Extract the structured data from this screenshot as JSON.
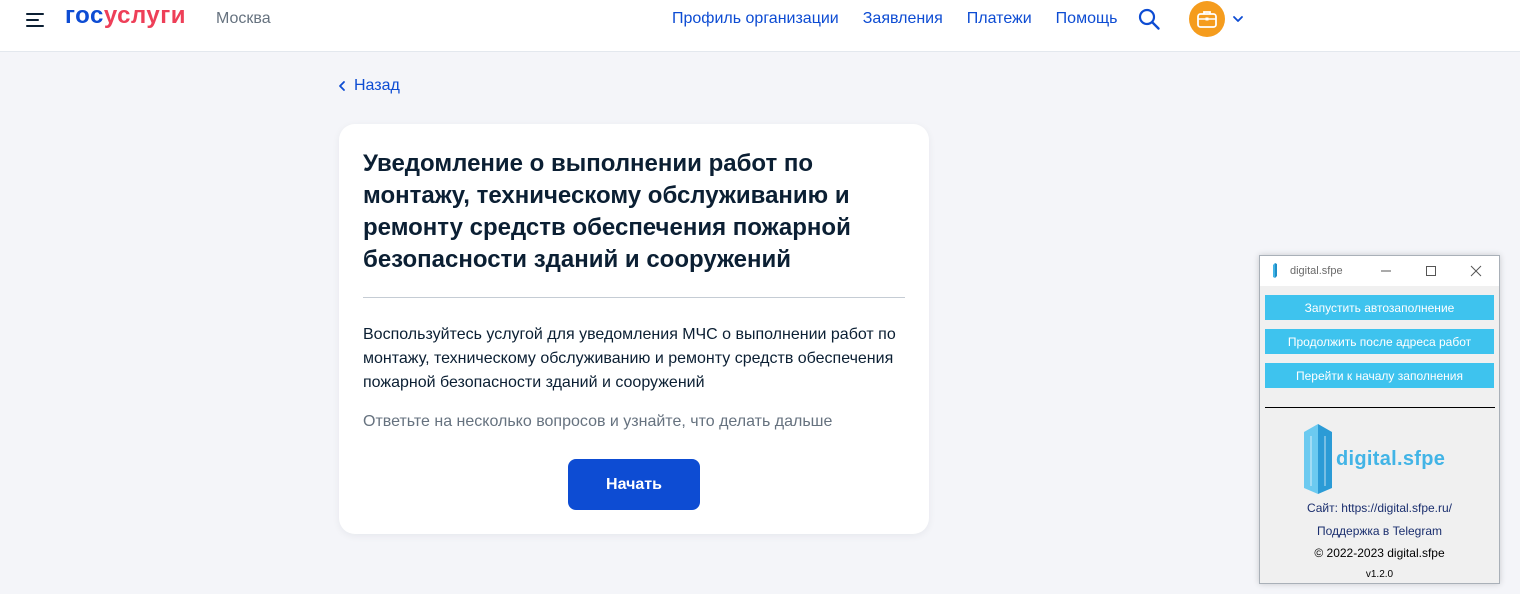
{
  "header": {
    "logo_part1": "гос",
    "logo_part2": "услуги",
    "city": "Москва",
    "nav": [
      "Профиль организации",
      "Заявления",
      "Платежи",
      "Помощь"
    ],
    "colors": {
      "brand_blue": "#0d4cd3",
      "brand_red": "#ee3f58",
      "avatar": "#f59c1d"
    }
  },
  "back_label": "Назад",
  "card": {
    "title": "Уведомление о выполнении работ по монтажу, техническому обслуживанию и ремонту средств обеспечения пожарной безопасности зданий и сооружений",
    "description": "Воспользуйтесь услугой для уведомления МЧС о выполнении работ по монтажу, техническому обслуживанию и ремонту средств обеспечения пожарной безопасности зданий и сооружений",
    "hint": "Ответьте на несколько вопросов и узнайте, что делать дальше",
    "start_label": "Начать"
  },
  "helper_window": {
    "title": "digital.sfpe",
    "buttons": [
      "Запустить автозаполнение",
      "Продолжить после адреса работ",
      "Перейти к началу заполнения"
    ],
    "logo_text": "digital.sfpe",
    "site": "Сайт: https://digital.sfpe.ru/",
    "support": "Поддержка в Telegram",
    "copyright": "© 2022-2023 digital.sfpe",
    "version": "v1.2.0",
    "colors": {
      "button": "#3ec3ee",
      "logo": "#42b4e6"
    }
  }
}
